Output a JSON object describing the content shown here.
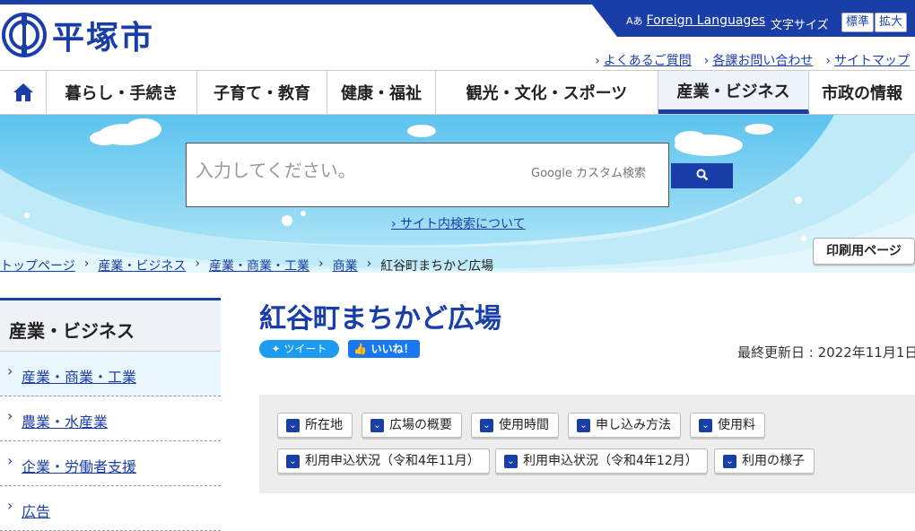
{
  "header": {
    "site_name": "平塚市",
    "foreign_languages": "Foreign Languages",
    "lang_icon": "Aあ",
    "font_size_label": "文字サイズ",
    "font_standard": "標準",
    "font_large": "拡大",
    "sublinks": [
      "よくあるご質問",
      "各課お問い合わせ",
      "サイトマップ"
    ]
  },
  "nav": {
    "items": [
      "暮らし・手続き",
      "子育て・教育",
      "健康・福祉",
      "観光・文化・スポーツ",
      "産業・ビジネス",
      "市政の情報"
    ],
    "active": "産業・ビジネス"
  },
  "search": {
    "placeholder": "入力してください。",
    "google_label": "Google カスタム検索",
    "about_link": "サイト内検索について"
  },
  "print_button": "印刷用ページ",
  "breadcrumb": [
    "トップページ",
    "産業・ビジネス",
    "産業・商業・工業",
    "商業"
  ],
  "breadcrumb_current": "紅谷町まちかど広場",
  "side": {
    "title": "産業・ビジネス",
    "items": [
      "産業・商業・工業",
      "農業・水産業",
      "企業・労働者支援",
      "広告"
    ]
  },
  "page": {
    "title": "紅谷町まちかど広場",
    "tweet": "ツイート",
    "like": "いいね！",
    "updated": "最終更新日 : 2022年11月1日"
  },
  "toc": [
    "所在地",
    "広場の概要",
    "使用時間",
    "申し込み方法",
    "使用料",
    "利用申込状況（令和4年11月）",
    "利用申込状況（令和4年12月）",
    "利用の様子"
  ],
  "colors": {
    "brand": "#1a3ea8",
    "sky": "#7fd0f0"
  }
}
